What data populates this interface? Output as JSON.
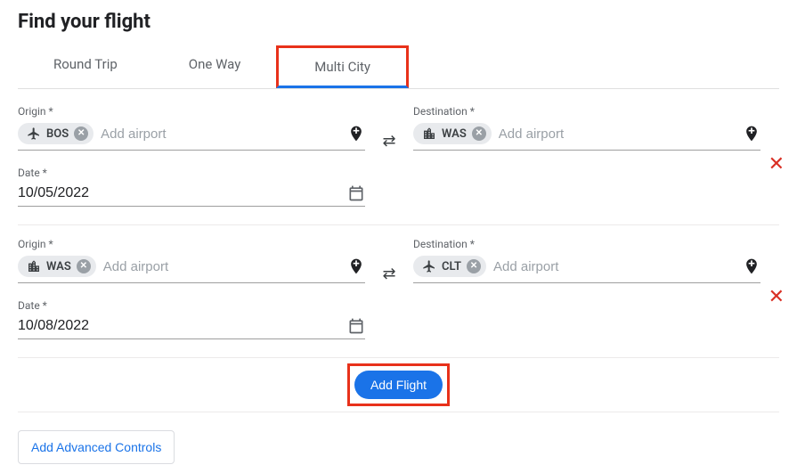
{
  "header": {
    "title": "Find your flight"
  },
  "tabs": {
    "round_trip": "Round Trip",
    "one_way": "One Way",
    "multi_city": "Multi City"
  },
  "labels": {
    "origin": "Origin *",
    "destination": "Destination *",
    "date": "Date *",
    "add_airport_placeholder": "Add airport"
  },
  "segments": [
    {
      "origin": {
        "code": "BOS",
        "icon": "airplane"
      },
      "destination": {
        "code": "WAS",
        "icon": "city"
      },
      "date": "10/05/2022"
    },
    {
      "origin": {
        "code": "WAS",
        "icon": "city"
      },
      "destination": {
        "code": "CLT",
        "icon": "airplane"
      },
      "date": "10/08/2022"
    }
  ],
  "buttons": {
    "add_flight": "Add Flight",
    "advanced": "Add Advanced Controls"
  }
}
